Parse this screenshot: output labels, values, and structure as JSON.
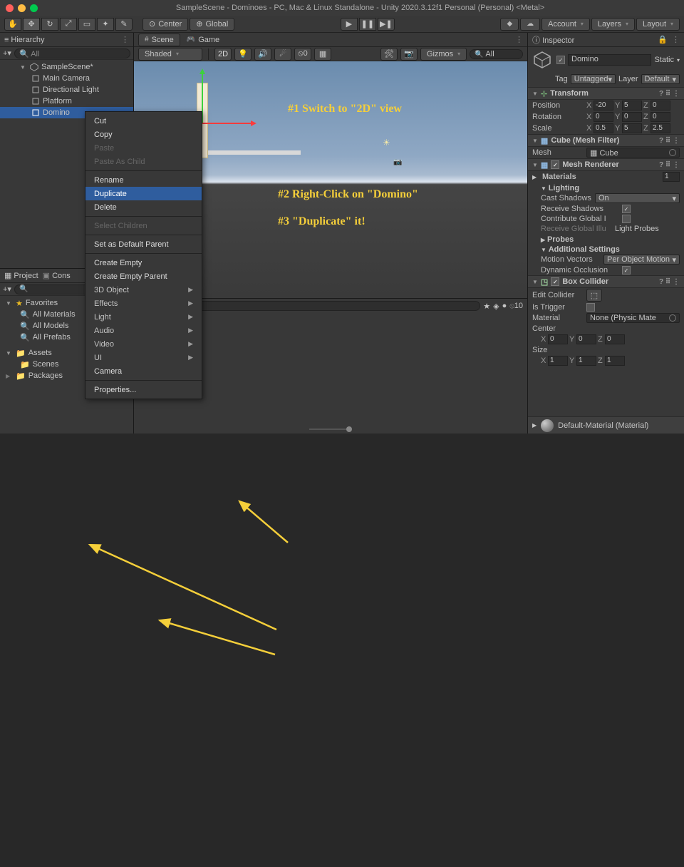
{
  "window_title": "SampleScene - Dominoes - PC, Mac & Linux Standalone - Unity 2020.3.12f1 Personal (Personal) <Metal>",
  "toolbar": {
    "pivot": "Center",
    "handle": "Global",
    "layers": "Layers",
    "layout": "Layout",
    "account": "Account"
  },
  "hierarchy": {
    "title": "Hierarchy",
    "search_placeholder": "All",
    "scene": "SampleScene*",
    "items": [
      "Main Camera",
      "Directional Light",
      "Platform",
      "Domino"
    ]
  },
  "project": {
    "tab_project": "Project",
    "tab_console": "Cons",
    "favorites": "Favorites",
    "fav_items": [
      "All Materials",
      "All Models",
      "All Prefabs"
    ],
    "assets": "Assets",
    "asset_items": [
      "Scenes"
    ],
    "packages": "Packages"
  },
  "scene": {
    "tab_scene": "Scene",
    "tab_game": "Game",
    "shading": "Shaded",
    "mode_2d": "2D",
    "gizmos": "Gizmos",
    "search_placeholder": "All"
  },
  "console_icons": {
    "count": "10"
  },
  "inspector": {
    "title": "Inspector",
    "name": "Domino",
    "static_label": "Static",
    "tag_label": "Tag",
    "tag_value": "Untagged",
    "layer_label": "Layer",
    "layer_value": "Default",
    "transform": {
      "title": "Transform",
      "position": {
        "label": "Position",
        "x": "-20",
        "y": "5",
        "z": "0"
      },
      "rotation": {
        "label": "Rotation",
        "x": "0",
        "y": "0",
        "z": "0"
      },
      "scale": {
        "label": "Scale",
        "x": "0.5",
        "y": "5",
        "z": "2.5"
      }
    },
    "mesh_filter": {
      "title": "Cube (Mesh Filter)",
      "mesh_label": "Mesh",
      "mesh_value": "Cube"
    },
    "mesh_renderer": {
      "title": "Mesh Renderer",
      "materials": "Materials",
      "materials_count": "1",
      "lighting": "Lighting",
      "cast_shadows": "Cast Shadows",
      "cast_shadows_value": "On",
      "receive_shadows": "Receive Shadows",
      "contribute_gi": "Contribute Global I",
      "receive_gi": "Receive Global Illu",
      "receive_gi_value": "Light Probes",
      "probes": "Probes",
      "additional": "Additional Settings",
      "motion_vectors": "Motion Vectors",
      "motion_vectors_value": "Per Object Motion",
      "dyn_occ": "Dynamic Occlusion"
    },
    "box_collider": {
      "title": "Box Collider",
      "edit_collider": "Edit Collider",
      "is_trigger": "Is Trigger",
      "material": "Material",
      "material_value": "None (Physic Mate",
      "center": "Center",
      "center_x": "0",
      "center_y": "0",
      "center_z": "0",
      "size": "Size",
      "size_x": "1",
      "size_y": "1",
      "size_z": "1"
    },
    "material_footer": "Default-Material (Material)"
  },
  "context": {
    "items": [
      "Cut",
      "Copy",
      "Paste",
      "Paste As Child",
      "Rename",
      "Duplicate",
      "Delete",
      "Select Children",
      "Set as Default Parent",
      "Create Empty",
      "Create Empty Parent",
      "3D Object",
      "Effects",
      "Light",
      "Audio",
      "Video",
      "UI",
      "Camera",
      "Properties..."
    ]
  },
  "annotations": {
    "a1": "#1  Switch to \"2D\" view",
    "a2": "#2  Right-Click on \"Domino\"",
    "a3": "#3  \"Duplicate\" it!"
  }
}
